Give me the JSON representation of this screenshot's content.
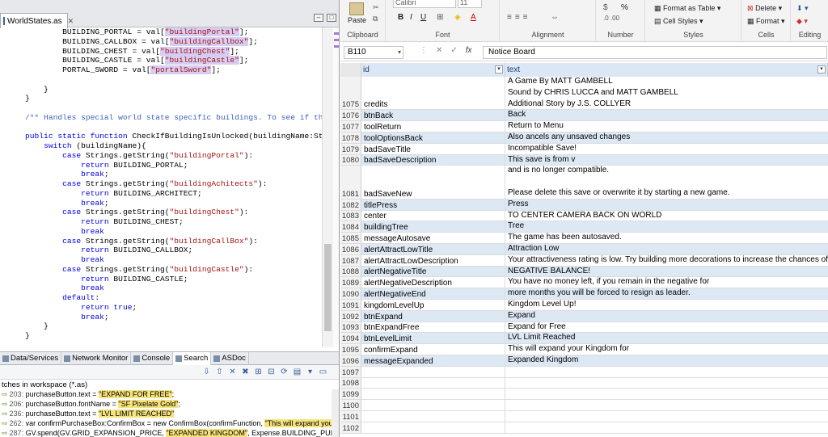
{
  "ide": {
    "tab_label": "WorldStates.as",
    "code_lines": [
      [
        {
          "t": "            BUILDING_PORTAL = val["
        },
        {
          "t": "\"buildingPortal\"",
          "c": "str hl"
        },
        {
          "t": "];"
        }
      ],
      [
        {
          "t": "            BUILDING_CALLBOX = val["
        },
        {
          "t": "\"buildingCallbox\"",
          "c": "str hl"
        },
        {
          "t": "];"
        }
      ],
      [
        {
          "t": "            BUILDING_CHEST = val["
        },
        {
          "t": "\"buildingChest\"",
          "c": "str hl"
        },
        {
          "t": "];"
        }
      ],
      [
        {
          "t": "            BUILDING_CASTLE = val["
        },
        {
          "t": "\"buildingCastle\"",
          "c": "str hl"
        },
        {
          "t": "];"
        }
      ],
      [
        {
          "t": "            PORTAL_SWORD = val["
        },
        {
          "t": "\"portalSword\"",
          "c": "str hl"
        },
        {
          "t": "];"
        }
      ],
      [
        {
          "t": ""
        }
      ],
      [
        {
          "t": "        }"
        }
      ],
      [
        {
          "t": "    }"
        }
      ],
      [
        {
          "t": ""
        }
      ],
      [
        {
          "t": "    /** Handles special world state specific buildings. To see if they sh",
          "c": "cm"
        }
      ],
      [
        {
          "t": ""
        }
      ],
      [
        {
          "t": "    "
        },
        {
          "t": "public static function",
          "c": "kw"
        },
        {
          "t": " CheckIfBuildingIsUnlocked(buildingName:String)"
        }
      ],
      [
        {
          "t": "        "
        },
        {
          "t": "switch",
          "c": "kw"
        },
        {
          "t": " (buildingName){"
        }
      ],
      [
        {
          "t": "            "
        },
        {
          "t": "case",
          "c": "kw"
        },
        {
          "t": " Strings.getString("
        },
        {
          "t": "\"buildingPortal\"",
          "c": "str"
        },
        {
          "t": "):"
        }
      ],
      [
        {
          "t": "                "
        },
        {
          "t": "return",
          "c": "kw"
        },
        {
          "t": " BUILDING_PORTAL;"
        }
      ],
      [
        {
          "t": "                "
        },
        {
          "t": "break",
          "c": "kw"
        },
        {
          "t": ";"
        }
      ],
      [
        {
          "t": "            "
        },
        {
          "t": "case",
          "c": "kw"
        },
        {
          "t": " Strings.getString("
        },
        {
          "t": "\"buildingAchitects\"",
          "c": "str"
        },
        {
          "t": "):"
        }
      ],
      [
        {
          "t": "                "
        },
        {
          "t": "return",
          "c": "kw"
        },
        {
          "t": " BUILDING_ARCHITECT;"
        }
      ],
      [
        {
          "t": "                "
        },
        {
          "t": "break",
          "c": "kw"
        },
        {
          "t": ";"
        }
      ],
      [
        {
          "t": "            "
        },
        {
          "t": "case",
          "c": "kw"
        },
        {
          "t": " Strings.getString("
        },
        {
          "t": "\"buildingChest\"",
          "c": "str"
        },
        {
          "t": "):"
        }
      ],
      [
        {
          "t": "                "
        },
        {
          "t": "return",
          "c": "kw"
        },
        {
          "t": " BUILDING_CHEST;"
        }
      ],
      [
        {
          "t": "                "
        },
        {
          "t": "break",
          "c": "kw"
        }
      ],
      [
        {
          "t": "            "
        },
        {
          "t": "case",
          "c": "kw"
        },
        {
          "t": " Strings.getString("
        },
        {
          "t": "\"buildingCallBox\"",
          "c": "str"
        },
        {
          "t": "):"
        }
      ],
      [
        {
          "t": "                "
        },
        {
          "t": "return",
          "c": "kw"
        },
        {
          "t": " BUILDING_CALLBOX;"
        }
      ],
      [
        {
          "t": "                "
        },
        {
          "t": "break",
          "c": "kw"
        }
      ],
      [
        {
          "t": "            "
        },
        {
          "t": "case",
          "c": "kw"
        },
        {
          "t": " Strings.getString("
        },
        {
          "t": "\"buildingCastle\"",
          "c": "str"
        },
        {
          "t": "):"
        }
      ],
      [
        {
          "t": "                "
        },
        {
          "t": "return",
          "c": "kw"
        },
        {
          "t": " BUILDING_CASTLE;"
        }
      ],
      [
        {
          "t": "                "
        },
        {
          "t": "break",
          "c": "kw"
        }
      ],
      [
        {
          "t": "            "
        },
        {
          "t": "default",
          "c": "kw"
        },
        {
          "t": ":"
        }
      ],
      [
        {
          "t": "                "
        },
        {
          "t": "return true",
          "c": "kw"
        },
        {
          "t": ";"
        }
      ],
      [
        {
          "t": "                "
        },
        {
          "t": "break",
          "c": "kw"
        },
        {
          "t": ";"
        }
      ],
      [
        {
          "t": "        }"
        }
      ],
      [
        {
          "t": "    }"
        }
      ]
    ],
    "panel_tabs": [
      {
        "label": "Data/Services",
        "active": false
      },
      {
        "label": "Network Monitor",
        "active": false
      },
      {
        "label": "Console",
        "active": false
      },
      {
        "label": "Search",
        "active": true
      },
      {
        "label": "ASDoc",
        "active": false
      }
    ],
    "results_title": "tches in workspace (*.as)",
    "results": [
      {
        "ln": "203:",
        "pre": " purchaseButton.text = ",
        "hit": "\"EXPAND FOR FREE\"",
        "post": ";"
      },
      {
        "ln": "206:",
        "pre": " purchaseButton.fontName = ",
        "hit": "\"SF Pixelate Gold\"",
        "post": ";"
      },
      {
        "ln": "236:",
        "pre": " purchaseButton.text = ",
        "hit": "\"LVL LIMIT REACHED\"",
        "post": ""
      },
      {
        "ln": "262:",
        "pre": " var confirmPurchaseBox:ConfirmBox = new ConfirmBox(confirmFunction, ",
        "hit": "\"This will expand your Kingdo",
        "post": ""
      },
      {
        "ln": "287:",
        "pre": " GV.spend(GV.GRID_EXPANSION_PRICE, ",
        "hit": "\"EXPANDED KINGDOM\"",
        "post": ", Expense.BUILDING_PURCHASE);"
      }
    ]
  },
  "excel": {
    "ribbon": {
      "font_name": "Calibri",
      "font_size": "11",
      "paste_label": "Paste",
      "clipboard_label": "Clipboard",
      "font_label": "Font",
      "alignment_label": "Alignment",
      "number_label": "Number",
      "styles_label": "Styles",
      "cells_label": "Cells",
      "editing_label": "Editing",
      "format_as_table": "Format as Table",
      "cell_styles": "Cell Styles",
      "delete_label": "Delete",
      "format_label": "Format",
      "percent_label": "%"
    },
    "name_box": "B110",
    "formula_value": "Notice Board",
    "fx_label": "fx",
    "col_a_header": "id",
    "col_b_header": "text",
    "rows": [
      {
        "num": "1075",
        "id": "credits",
        "text": "A Game By MATT GAMBELL\nSound by CHRIS LUCCA and MATT GAMBELL\nAdditional Story by J.S. COLLYER",
        "band": false
      },
      {
        "num": "1076",
        "id": "btnBack",
        "text": "Back",
        "band": true
      },
      {
        "num": "1077",
        "id": "toolReturn",
        "text": "Return to Menu",
        "band": false
      },
      {
        "num": "1078",
        "id": "toolOptionsBack",
        "text": "Also ancels any unsaved changes",
        "band": true
      },
      {
        "num": "1079",
        "id": "badSaveTitle",
        "text": "Incompatible Save!",
        "band": false
      },
      {
        "num": "1080",
        "id": "badSaveDescription",
        "text": "This save is from v",
        "band": true
      },
      {
        "num": "1081",
        "id": "badSaveNew",
        "text": "and is no longer compatible.\n\nPlease delete this save or overwrite it by starting a new game.",
        "band": false
      },
      {
        "num": "1082",
        "id": "titlePress",
        "text": "Press",
        "band": true
      },
      {
        "num": "1083",
        "id": "center",
        "text": "TO CENTER CAMERA BACK ON WORLD",
        "band": false
      },
      {
        "num": "1084",
        "id": "buildingTree",
        "text": "Tree",
        "band": true
      },
      {
        "num": "1085",
        "id": "messageAutosave",
        "text": "The game has been autosaved.",
        "band": false
      },
      {
        "num": "1086",
        "id": "alertAttractLowTitle",
        "text": "Attraction Low",
        "band": true
      },
      {
        "num": "1087",
        "id": "alertAttractLowDescription",
        "text": "Your attractiveness rating is low. Try building more decorations to increase the chances of adv",
        "band": false
      },
      {
        "num": "1088",
        "id": "alertNegativeTitle",
        "text": "NEGATIVE BALANCE!",
        "band": true
      },
      {
        "num": "1089",
        "id": "alertNegativeDescription",
        "text": "You have no money left, if you remain in the negative for",
        "band": false
      },
      {
        "num": "1090",
        "id": "alertNegativeEnd",
        "text": "more months you will be forced to resign as leader.",
        "band": true
      },
      {
        "num": "1091",
        "id": "kingdomLevelUp",
        "text": "Kingdom Level Up!",
        "band": false
      },
      {
        "num": "1092",
        "id": "btnExpand",
        "text": "Expand",
        "band": true
      },
      {
        "num": "1093",
        "id": "btnExpandFree",
        "text": "Expand for Free",
        "band": false
      },
      {
        "num": "1094",
        "id": "btnLevelLimit",
        "text": "LVL Limit Reached",
        "band": true
      },
      {
        "num": "1095",
        "id": "confirmExpand",
        "text": "This will expand your Kingdom for",
        "band": false
      },
      {
        "num": "1096",
        "id": "messageExpanded",
        "text": "Expanded Kingdom",
        "band": true
      },
      {
        "num": "1097",
        "id": "",
        "text": "",
        "band": false
      },
      {
        "num": "1098",
        "id": "",
        "text": "",
        "band": false
      },
      {
        "num": "1099",
        "id": "",
        "text": "",
        "band": false
      },
      {
        "num": "1100",
        "id": "",
        "text": "",
        "band": false
      },
      {
        "num": "1101",
        "id": "",
        "text": "",
        "band": false
      },
      {
        "num": "1102",
        "id": "",
        "text": "",
        "band": false
      }
    ]
  }
}
